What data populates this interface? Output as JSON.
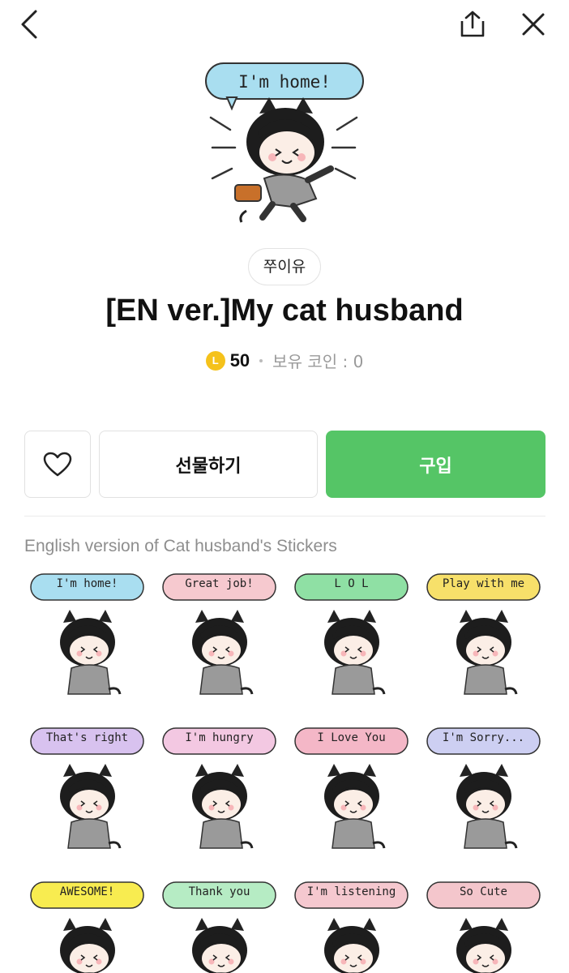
{
  "header": {
    "back_icon": "chevron-left-icon",
    "share_icon": "share-icon",
    "close_icon": "close-icon"
  },
  "hero": {
    "bubble_text": "I'm home!",
    "bubble_color": "#a9def0"
  },
  "author": "쭈이유",
  "title": "[EN ver.]My cat husband",
  "price": {
    "coin_label": "L",
    "amount": "50",
    "owned_coins": "보유 코인 : 0"
  },
  "actions": {
    "like_icon": "heart-outline-icon",
    "gift_label": "선물하기",
    "buy_label": "구입",
    "buy_color": "#55c566"
  },
  "description": "English version of Cat husband's Stickers",
  "stickers": [
    {
      "text": "I'm home!",
      "color": "#a9def0"
    },
    {
      "text": "Great job!",
      "color": "#f6c9cf"
    },
    {
      "text": "L O L",
      "color": "#8fe0a4"
    },
    {
      "text": "Play with me",
      "color": "#f7e06a"
    },
    {
      "text": "That's right",
      "color": "#d8c2ef"
    },
    {
      "text": "I'm hungry",
      "color": "#f3c8e2"
    },
    {
      "text": "I Love You",
      "color": "#f4b7c7"
    },
    {
      "text": "I'm Sorry...",
      "color": "#cdcff2"
    },
    {
      "text": "AWESOME!",
      "color": "#f8ec50"
    },
    {
      "text": "Thank you",
      "color": "#b6ecc4"
    },
    {
      "text": "I'm listening",
      "color": "#f5c8cf"
    },
    {
      "text": "So Cute",
      "color": "#f4c6cc"
    }
  ]
}
